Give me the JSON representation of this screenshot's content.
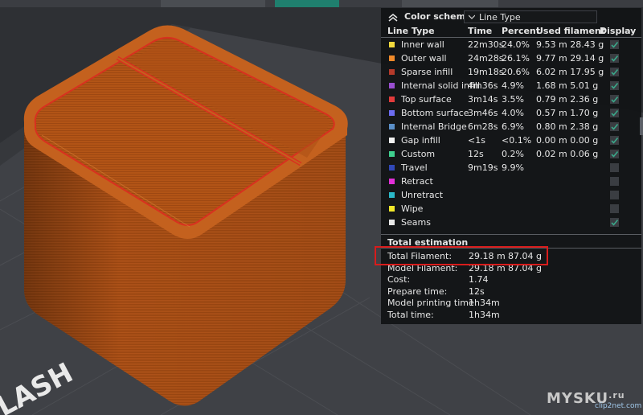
{
  "color_scheme": {
    "title": "Color scheme",
    "selected": "Line Type"
  },
  "table": {
    "headers": {
      "line_type": "Line Type",
      "time": "Time",
      "percent": "Percent",
      "used_filament": "Used filament",
      "display": "Display"
    },
    "rows": [
      {
        "name": "Inner wall",
        "color": "#f2d83c",
        "time": "22m30s",
        "percent": "24.0%",
        "used": "9.53 m  28.43 g",
        "display": true
      },
      {
        "name": "Outer wall",
        "color": "#f08a2a",
        "time": "24m28s",
        "percent": "26.1%",
        "used": "9.77 m  29.14 g",
        "display": true
      },
      {
        "name": "Sparse infill",
        "color": "#b53a2a",
        "time": "19m18s",
        "percent": "20.6%",
        "used": "6.02 m  17.95 g",
        "display": true
      },
      {
        "name": "Internal solid infill",
        "color": "#9a4fd0",
        "time": "4m36s",
        "percent": "4.9%",
        "used": "1.68 m  5.01 g",
        "display": true
      },
      {
        "name": "Top surface",
        "color": "#e23b3b",
        "time": "3m14s",
        "percent": "3.5%",
        "used": "0.79 m  2.36 g",
        "display": true
      },
      {
        "name": "Bottom surface",
        "color": "#6c6cf0",
        "time": "3m46s",
        "percent": "4.0%",
        "used": "0.57 m  1.70 g",
        "display": true
      },
      {
        "name": "Internal Bridge",
        "color": "#5a8fc8",
        "time": "6m28s",
        "percent": "6.9%",
        "used": "0.80 m  2.38 g",
        "display": true
      },
      {
        "name": "Gap infill",
        "color": "#f2f2f2",
        "time": "<1s",
        "percent": "<0.1%",
        "used": "0.00 m  0.00 g",
        "display": true
      },
      {
        "name": "Custom",
        "color": "#3ecf8e",
        "time": "12s",
        "percent": "0.2%",
        "used": "0.02 m  0.06 g",
        "display": true
      },
      {
        "name": "Travel",
        "color": "#3048b8",
        "time": "9m19s",
        "percent": "9.9%",
        "used": "",
        "display": false
      },
      {
        "name": "Retract",
        "color": "#e22fd8",
        "time": "",
        "percent": "",
        "used": "",
        "display": false
      },
      {
        "name": "Unretract",
        "color": "#2ab8c8",
        "time": "",
        "percent": "",
        "used": "",
        "display": false
      },
      {
        "name": "Wipe",
        "color": "#f2e82a",
        "time": "",
        "percent": "",
        "used": "",
        "display": false
      },
      {
        "name": "Seams",
        "color": "#e8e8e8",
        "time": "",
        "percent": "",
        "used": "",
        "display": true
      }
    ]
  },
  "total_estimation": {
    "title": "Total estimation",
    "rows": [
      {
        "label": "Total Filament:",
        "v1": "29.18 m",
        "v2": "87.04 g"
      },
      {
        "label": "Model Filament:",
        "v1": "29.18 m",
        "v2": "87.04 g"
      },
      {
        "label": "Cost:",
        "v1": "1.74",
        "v2": ""
      },
      {
        "label": "Prepare time:",
        "v1": "12s",
        "v2": ""
      },
      {
        "label": "Model printing time:",
        "v1": "1h34m",
        "v2": ""
      },
      {
        "label": "Total time:",
        "v1": "1h34m",
        "v2": ""
      }
    ]
  },
  "watermark": {
    "main": "MYSKU",
    "ru": ".ru",
    "sub": "clip2net.com"
  },
  "colors": {
    "accent": "#3aa88a",
    "model": "#b8571a",
    "highlight": "#d81c1c"
  },
  "icons": {
    "collapse": "double-chevron-up-icon",
    "dropdown": "chevron-down-icon",
    "check": "check-icon"
  }
}
